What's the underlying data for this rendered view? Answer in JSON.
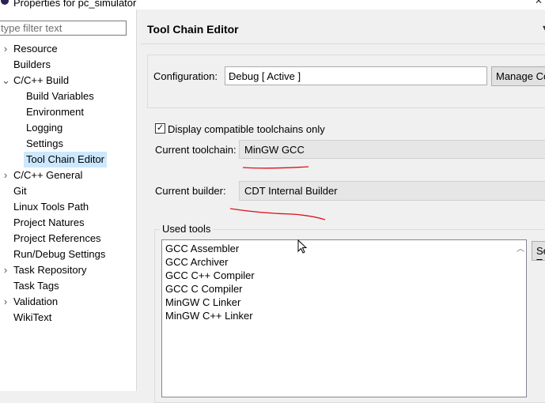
{
  "window": {
    "title": "Properties for pc_simulator",
    "close_glyph": "✕"
  },
  "filter": {
    "placeholder": "type filter text",
    "value": ""
  },
  "tree": [
    {
      "label": "Resource",
      "twisty": "›",
      "level": 0,
      "selected": false
    },
    {
      "label": "Builders",
      "twisty": "",
      "level": 0,
      "selected": false
    },
    {
      "label": "C/C++ Build",
      "twisty": "⌄",
      "level": 0,
      "selected": false
    },
    {
      "label": "Build Variables",
      "twisty": "",
      "level": 1,
      "selected": false
    },
    {
      "label": "Environment",
      "twisty": "",
      "level": 1,
      "selected": false
    },
    {
      "label": "Logging",
      "twisty": "",
      "level": 1,
      "selected": false
    },
    {
      "label": "Settings",
      "twisty": "",
      "level": 1,
      "selected": false
    },
    {
      "label": "Tool Chain Editor",
      "twisty": "",
      "level": 1,
      "selected": true
    },
    {
      "label": "C/C++ General",
      "twisty": "›",
      "level": 0,
      "selected": false
    },
    {
      "label": "Git",
      "twisty": "",
      "level": 0,
      "selected": false
    },
    {
      "label": "Linux Tools Path",
      "twisty": "",
      "level": 0,
      "selected": false
    },
    {
      "label": "Project Natures",
      "twisty": "",
      "level": 0,
      "selected": false
    },
    {
      "label": "Project References",
      "twisty": "",
      "level": 0,
      "selected": false
    },
    {
      "label": "Run/Debug Settings",
      "twisty": "",
      "level": 0,
      "selected": false
    },
    {
      "label": "Task Repository",
      "twisty": "›",
      "level": 0,
      "selected": false
    },
    {
      "label": "Task Tags",
      "twisty": "",
      "level": 0,
      "selected": false
    },
    {
      "label": "Validation",
      "twisty": "›",
      "level": 0,
      "selected": false
    },
    {
      "label": "WikiText",
      "twisty": "",
      "level": 0,
      "selected": false
    }
  ],
  "page": {
    "title": "Tool Chain Editor",
    "menu_glyph": "▾"
  },
  "configuration": {
    "label": "Configuration:",
    "value": "Debug  [ Active ]",
    "manage_label": "Manage Configurations..."
  },
  "toolchain": {
    "checkbox_label": "Display compatible toolchains only",
    "checked": true,
    "current_toolchain_label": "Current toolchain:",
    "current_toolchain_value": "MinGW GCC",
    "current_builder_label": "Current builder:",
    "current_builder_value": "CDT Internal Builder"
  },
  "used_tools": {
    "legend": "Used tools",
    "items": [
      "GCC Assembler",
      "GCC Archiver",
      "GCC C++ Compiler",
      "GCC C Compiler",
      "MinGW C Linker",
      "MinGW C++ Linker"
    ],
    "select_label": "Select Tools..."
  },
  "colors": {
    "annotation": "#e0101a",
    "selection": "#cce8ff"
  }
}
